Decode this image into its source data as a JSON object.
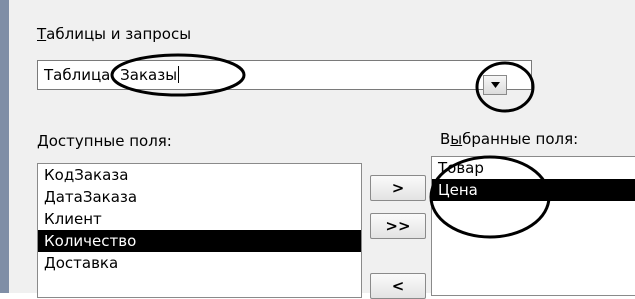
{
  "tables_queries_label_first": "Т",
  "tables_queries_label_rest": "аблицы и запросы",
  "table_combo_value": "Таблица: Заказы",
  "available_fields_label_first": "Д",
  "available_fields_label_rest": "оступные поля:",
  "selected_fields_label_a": "В",
  "selected_fields_label_b": "ы",
  "selected_fields_label_c": "бранные поля:",
  "available_fields": [
    "КодЗаказа",
    "ДатаЗаказа",
    "Клиент",
    "Количество",
    "Доставка"
  ],
  "available_selected_index": 3,
  "selected_fields": [
    "Товар",
    "Цена"
  ],
  "selected_selected_index": 1,
  "move_one_label": ">",
  "move_all_label": ">>",
  "move_back_label": "<",
  "colors": {
    "selection_bg": "#000000",
    "dialog_bg": "#f0f0f0",
    "left_bar": "#7f8ea6"
  }
}
